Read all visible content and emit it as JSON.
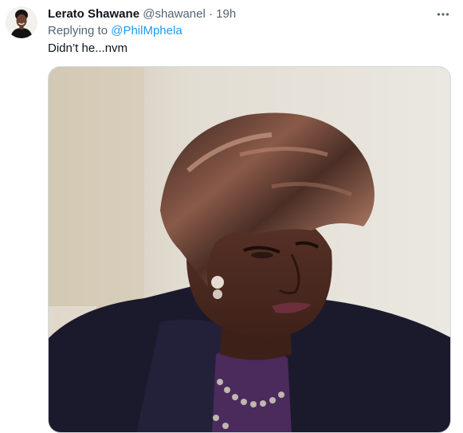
{
  "tweet": {
    "author": {
      "display_name": "Lerato Shawane",
      "handle": "@shawanel",
      "avatar_icon": "profile-avatar"
    },
    "separator": "·",
    "timestamp": "19h",
    "reply_prefix": "Replying to",
    "reply_to": "@PhilMphela",
    "text": "Didn’t he...nvm",
    "more_icon": "more-horizontal-icon",
    "media": {
      "type": "gif-image",
      "icon": "media-image"
    }
  },
  "colors": {
    "text_primary": "#0f1419",
    "text_secondary": "#536471",
    "accent": "#1d9bf0",
    "border": "#cfd9de"
  }
}
